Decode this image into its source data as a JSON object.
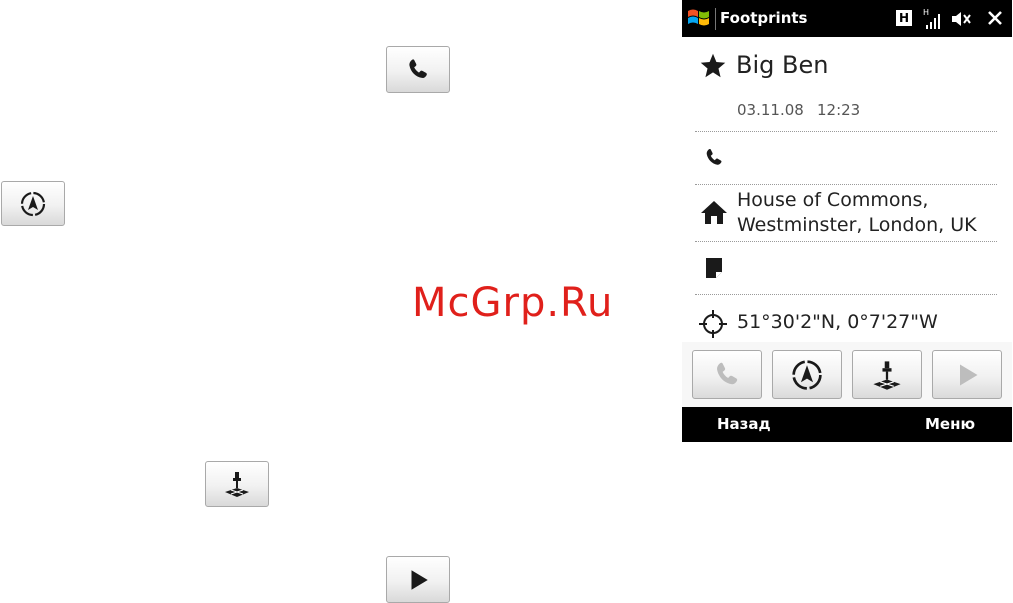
{
  "watermark": "McGrp.Ru",
  "phone": {
    "app_title": "Footprints",
    "status_icons": [
      "windows-logo-icon",
      "h-network-icon",
      "signal-icon",
      "speaker-muted-icon",
      "close-icon"
    ],
    "network_label": "H",
    "place": {
      "name": "Big Ben",
      "date": "03.11.08",
      "time": "12:23",
      "phone": "",
      "address_line1": "House of Commons,",
      "address_line2": "Westminster, London, UK",
      "note": "",
      "coordinates": "51°30'2\"N, 0°7'27\"W"
    },
    "softkeys": {
      "left": "Назад",
      "right": "Меню"
    }
  }
}
